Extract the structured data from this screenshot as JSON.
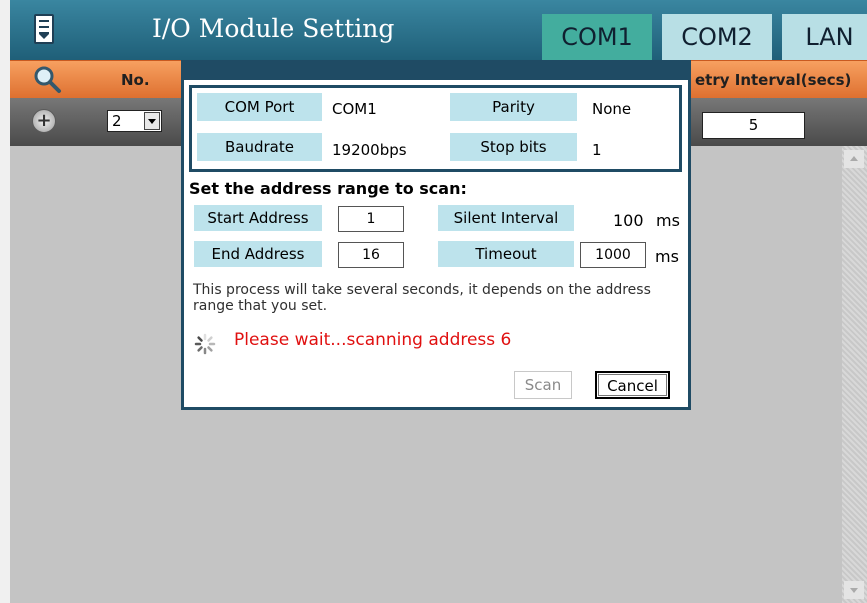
{
  "app": {
    "title": "I/O Module Setting",
    "tabs": [
      {
        "label": "COM1",
        "active": true
      },
      {
        "label": "COM2",
        "active": false
      },
      {
        "label": "LAN",
        "active": false
      }
    ]
  },
  "table": {
    "header_no": "No.",
    "header_retry": "etry Interval(secs)",
    "no_value": "2",
    "retry_value": "5"
  },
  "dialog": {
    "com_port_label": "COM Port",
    "com_port_value": "COM1",
    "parity_label": "Parity",
    "parity_value": "None",
    "baudrate_label": "Baudrate",
    "baudrate_value": "19200bps",
    "stop_bits_label": "Stop bits",
    "stop_bits_value": "1",
    "scan_heading": "Set the address range to scan:",
    "start_address_label": "Start Address",
    "start_address_value": "1",
    "end_address_label": "End Address",
    "end_address_value": "16",
    "silent_interval_label": "Silent Interval",
    "silent_interval_value": "100",
    "silent_interval_unit": "ms",
    "timeout_label": "Timeout",
    "timeout_value": "1000",
    "timeout_unit": "ms",
    "note": "This process will take several seconds, it depends on the address range that you set.",
    "status": "Please wait...scanning address 6",
    "scan_button": "Scan",
    "cancel_button": "Cancel"
  },
  "colors": {
    "title_bar": "#2b7390",
    "active_tab": "#43ad9e",
    "inactive_tab": "#b8dfe5",
    "header_row": "#ec8848",
    "label_bg": "#bde3ec",
    "status_text": "#e01010"
  },
  "icons": {
    "menu": "document-menu-icon",
    "search": "magnifier-icon",
    "add": "plus-circle-icon",
    "busy": "spinner-icon"
  }
}
